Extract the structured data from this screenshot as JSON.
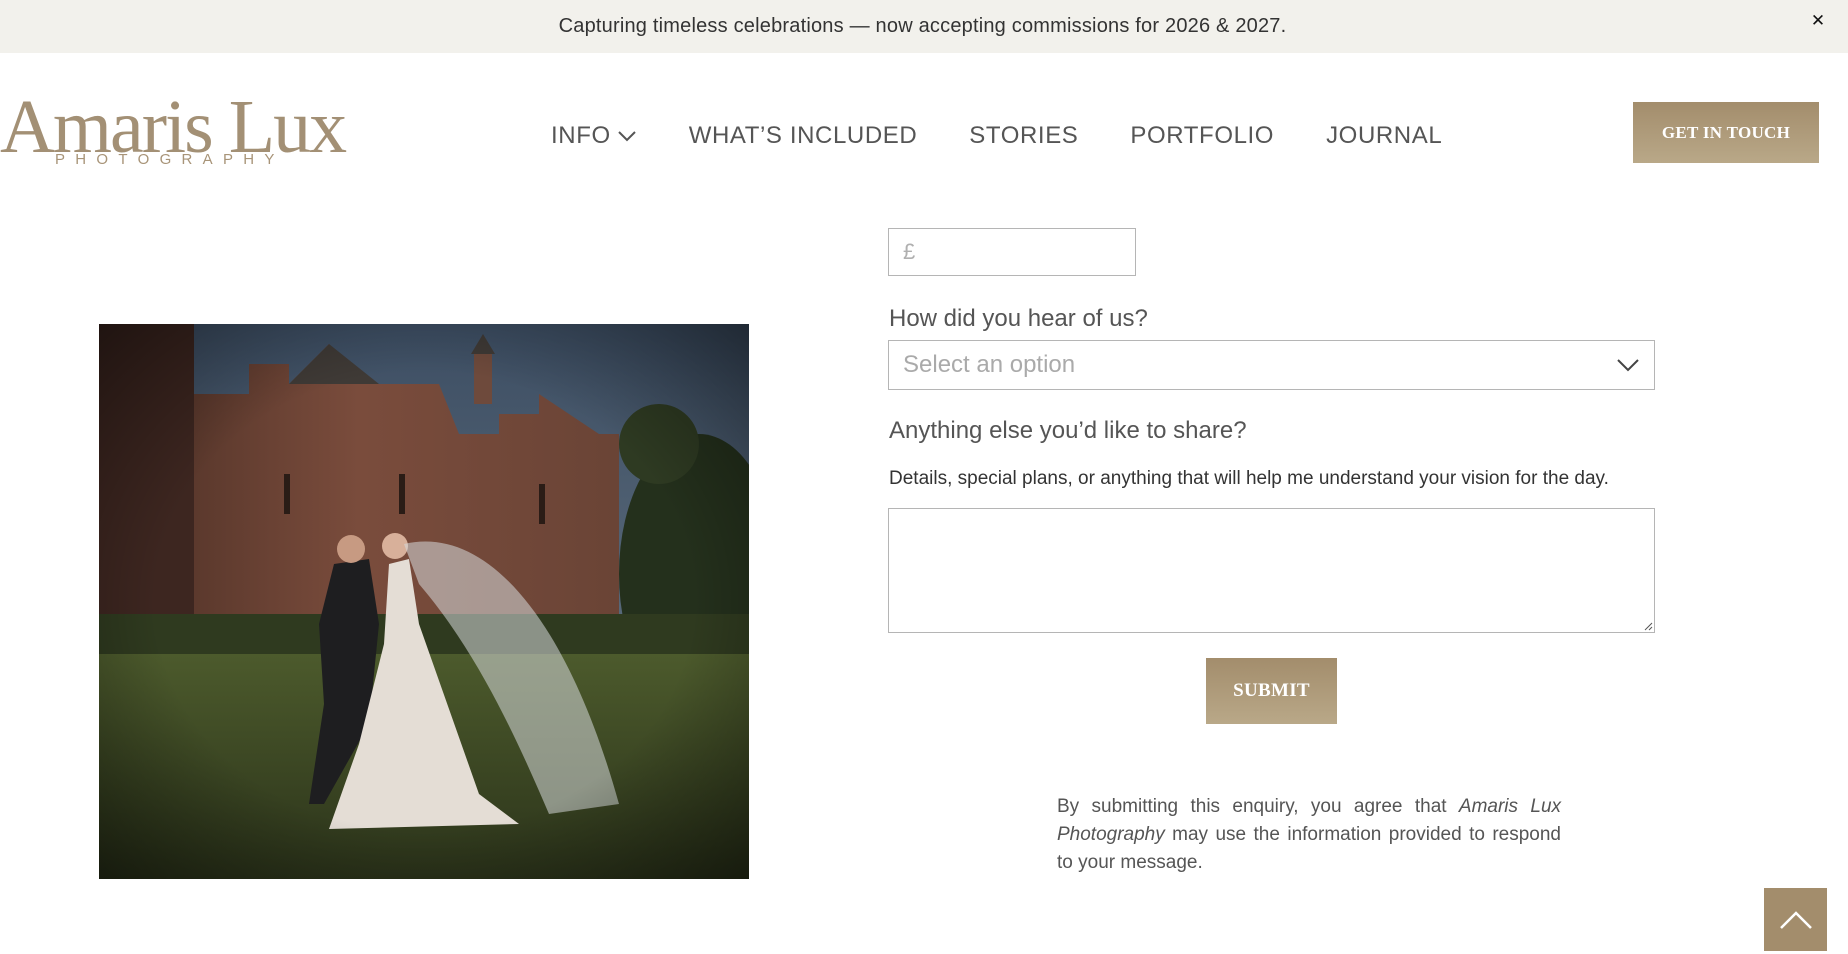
{
  "announcement": {
    "text": "Capturing timeless celebrations — now accepting commissions for 2026 & 2027.",
    "close_icon": "close-icon",
    "close_glyph": "✕"
  },
  "brand": {
    "name": "Amaris Lux",
    "tagline": "PHOTOGRAPHY",
    "color": "#a39075"
  },
  "nav": {
    "items": [
      {
        "label": "INFO",
        "has_dropdown": true
      },
      {
        "label": "WHAT’S INCLUDED"
      },
      {
        "label": "STORIES"
      },
      {
        "label": "PORTFOLIO"
      },
      {
        "label": "JOURNAL"
      }
    ],
    "cta_label": "GET IN TOUCH"
  },
  "form": {
    "budget": {
      "value": "",
      "placeholder": "£"
    },
    "heard": {
      "label": "How did you hear of us?",
      "selected": "Select an option"
    },
    "share": {
      "label": "Anything else you’d like to share?",
      "help": "Details, special plans, or anything that will help me understand your vision for the day.",
      "value": ""
    },
    "submit_label": "SUBMIT",
    "consent": {
      "before": "By submitting this enquiry, you agree that ",
      "brand": "Amaris Lux Photography",
      "after": " may use the information provided to respond to your message."
    }
  },
  "photo": {
    "icon": "wedding-photo"
  },
  "back_to_top": {
    "icon": "arrow-up-icon"
  },
  "colors": {
    "accent": "#a38d6c",
    "announce_bg": "#f2f1ec",
    "text": "#555555"
  }
}
